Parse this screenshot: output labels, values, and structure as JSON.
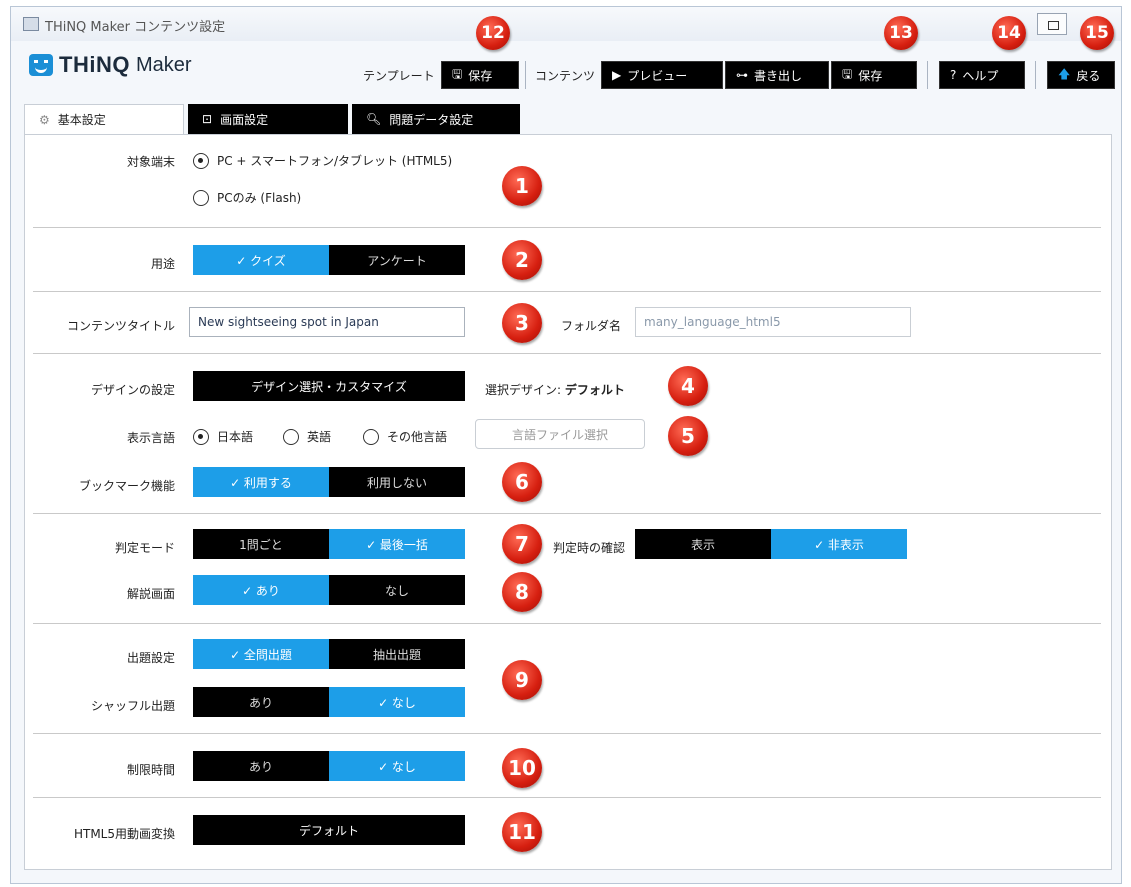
{
  "window": {
    "title": "THiNQ Maker コンテンツ設定"
  },
  "logo": {
    "main": "THiNQ",
    "sub": "Maker"
  },
  "toolbar": {
    "template_label": "テンプレート",
    "template_save": "保存",
    "content_label": "コンテンツ",
    "preview": "プレビュー",
    "export": "書き出し",
    "save": "保存",
    "help": "ヘルプ",
    "back": "戻る"
  },
  "tabs": [
    {
      "label": "基本設定",
      "icon": "gear-icon"
    },
    {
      "label": "画面設定",
      "icon": "screen-icon"
    },
    {
      "label": "問題データ設定",
      "icon": "search-icon"
    }
  ],
  "form": {
    "target": {
      "label": "対象端末",
      "options": [
        "PC + スマートフォン/タブレット (HTML5)",
        "PCのみ (Flash)"
      ],
      "selected": 0
    },
    "usage": {
      "label": "用途",
      "options": [
        "✓ クイズ",
        "アンケート"
      ],
      "selected": 0
    },
    "content_title": {
      "label": "コンテンツタイトル",
      "value": "New sightseeing spot in Japan"
    },
    "folder": {
      "label": "フォルダ名",
      "value": "many_language_html5"
    },
    "design": {
      "label": "デザインの設定",
      "button": "デザイン選択・カスタマイズ",
      "selected_label": "選択デザイン:",
      "selected_value": "デフォルト"
    },
    "language": {
      "label": "表示言語",
      "options": [
        "日本語",
        "英語",
        "その他言語"
      ],
      "selected": 0,
      "file_button": "言語ファイル選択"
    },
    "bookmark": {
      "label": "ブックマーク機能",
      "options": [
        "✓ 利用する",
        "利用しない"
      ],
      "selected": 0
    },
    "judge_mode": {
      "label": "判定モード",
      "options": [
        "1問ごと",
        "✓ 最後一括"
      ],
      "selected": 1
    },
    "judge_confirm": {
      "label": "判定時の確認",
      "options": [
        "表示",
        "✓ 非表示"
      ],
      "selected": 1
    },
    "explanation": {
      "label": "解説画面",
      "options": [
        "✓ あり",
        "なし"
      ],
      "selected": 0
    },
    "question_mode": {
      "label": "出題設定",
      "options": [
        "✓ 全問出題",
        "抽出出題"
      ],
      "selected": 0
    },
    "shuffle": {
      "label": "シャッフル出題",
      "options": [
        "あり",
        "✓ なし"
      ],
      "selected": 1
    },
    "time_limit": {
      "label": "制限時間",
      "options": [
        "あり",
        "✓ なし"
      ],
      "selected": 1
    },
    "video": {
      "label": "HTML5用動画変換",
      "button": "デフォルト"
    }
  },
  "badges": [
    "1",
    "2",
    "3",
    "4",
    "5",
    "6",
    "7",
    "8",
    "9",
    "10",
    "11",
    "12",
    "13",
    "14",
    "15"
  ],
  "colors": {
    "accent": "#1d9ee8",
    "badge": "#d61f10",
    "dark": "#000000"
  }
}
